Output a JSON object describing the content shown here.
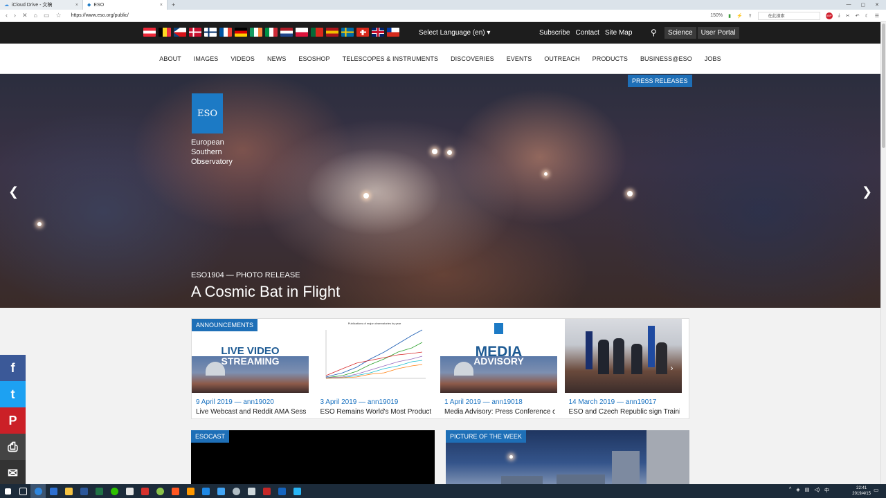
{
  "browser": {
    "tabs": [
      {
        "title": "iCloud Drive - 文稿"
      },
      {
        "title": "ESO"
      }
    ],
    "url": "https://www.eso.org/public/",
    "zoom": "150%",
    "search_placeholder": "在此搜索"
  },
  "topbar": {
    "flags": [
      {
        "name": "austria",
        "colors": [
          "#ed2939",
          "#ffffff",
          "#ed2939"
        ],
        "dir": "h"
      },
      {
        "name": "belgium",
        "colors": [
          "#000000",
          "#fdda24",
          "#ef3340"
        ],
        "dir": "v"
      },
      {
        "name": "czech",
        "colors": [
          "#ffffff",
          "#d7141a",
          "#11457e"
        ],
        "dir": "cz"
      },
      {
        "name": "denmark",
        "colors": [
          "#c8102e",
          "#ffffff"
        ],
        "dir": "cross"
      },
      {
        "name": "finland",
        "colors": [
          "#ffffff",
          "#002f6c"
        ],
        "dir": "cross"
      },
      {
        "name": "france",
        "colors": [
          "#0055a4",
          "#ffffff",
          "#ef4135"
        ],
        "dir": "v"
      },
      {
        "name": "germany",
        "colors": [
          "#000000",
          "#dd0000",
          "#ffce00"
        ],
        "dir": "h"
      },
      {
        "name": "ireland",
        "colors": [
          "#169b62",
          "#ffffff",
          "#ff883e"
        ],
        "dir": "v"
      },
      {
        "name": "italy",
        "colors": [
          "#009246",
          "#ffffff",
          "#ce2b37"
        ],
        "dir": "v"
      },
      {
        "name": "netherlands",
        "colors": [
          "#ae1c28",
          "#ffffff",
          "#21468b"
        ],
        "dir": "h"
      },
      {
        "name": "poland",
        "colors": [
          "#ffffff",
          "#dc143c"
        ],
        "dir": "h"
      },
      {
        "name": "portugal",
        "colors": [
          "#046a38",
          "#da291c"
        ],
        "dir": "pt"
      },
      {
        "name": "spain",
        "colors": [
          "#aa151b",
          "#f1bf00",
          "#aa151b"
        ],
        "dir": "h"
      },
      {
        "name": "sweden",
        "colors": [
          "#006aa7",
          "#fecc00"
        ],
        "dir": "cross"
      },
      {
        "name": "switzerland",
        "colors": [
          "#da291c",
          "#ffffff"
        ],
        "dir": "plus"
      },
      {
        "name": "uk",
        "colors": [
          "#012169",
          "#ffffff",
          "#c8102e"
        ],
        "dir": "uk"
      },
      {
        "name": "chile",
        "colors": [
          "#ffffff",
          "#d52b1e",
          "#0039a6"
        ],
        "dir": "cl"
      }
    ],
    "language": "Select Language (en)",
    "links": [
      "Subscribe",
      "Contact",
      "Site Map"
    ],
    "pills": [
      "Science",
      "User Portal"
    ]
  },
  "nav": [
    "ABOUT",
    "IMAGES",
    "VIDEOS",
    "NEWS",
    "ESOSHOP",
    "TELESCOPES & INSTRUMENTS",
    "DISCOVERIES",
    "EVENTS",
    "OUTREACH",
    "PRODUCTS",
    "BUSINESS@ESO",
    "JOBS"
  ],
  "hero": {
    "tag": "PRESS RELEASES",
    "logo_text": "ESO",
    "org_name": [
      "European",
      "Southern",
      "Observatory"
    ],
    "kicker": "ESO1904 — PHOTO RELEASE",
    "headline": "A Cosmic Bat in Flight"
  },
  "announcements": {
    "tag": "ANNOUNCEMENTS",
    "items": [
      {
        "poster": [
          "LIVE VIDEO",
          "STREAMING"
        ],
        "meta": "9 April 2019 — ann19020",
        "desc": "Live Webcast and Reddit AMA Session"
      },
      {
        "chart_title": "Publications of major observatories by year",
        "meta": "3 April 2019 — ann19019",
        "desc": "ESO Remains World's Most Productive"
      },
      {
        "poster": [
          "MEDIA",
          "ADVISORY"
        ],
        "meta": "1 April 2019 — ann19018",
        "desc": "Media Advisory: Press Conference on"
      },
      {
        "meta": "14 March 2019 — ann19017",
        "desc": "ESO and Czech Republic sign Training"
      }
    ]
  },
  "tiles": {
    "esocast": "ESOCAST",
    "potw": "PICTURE OF THE WEEK"
  },
  "social": [
    {
      "name": "facebook",
      "glyph": "f",
      "color": "#3b5998"
    },
    {
      "name": "twitter",
      "glyph": "t",
      "color": "#1da1f2"
    },
    {
      "name": "pinterest",
      "glyph": "P",
      "color": "#cb2027"
    },
    {
      "name": "print",
      "glyph": "⎙",
      "color": "#444444"
    },
    {
      "name": "email",
      "glyph": "✉",
      "color": "#333333"
    }
  ],
  "taskbar": {
    "time": "22:41",
    "date": "2019/4/15",
    "ime": "中"
  }
}
